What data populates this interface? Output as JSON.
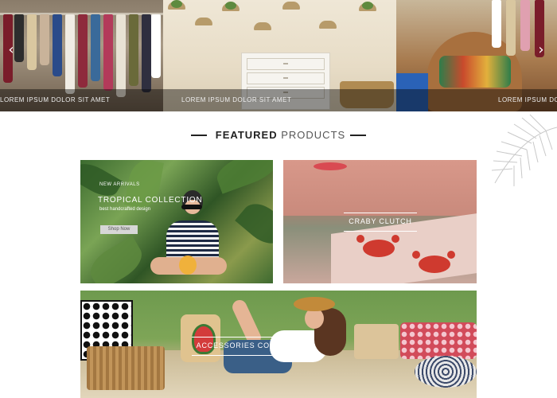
{
  "carousel": {
    "caption_left": "LOREM IPSUM DOLOR SIT AMET",
    "caption_center": "LOREM IPSUM DOLOR SIT AMET",
    "caption_right": "LOREM IPSUM DOLOR",
    "prev_icon": "‹",
    "next_icon": "›"
  },
  "featured": {
    "title_bold": "FEATURED",
    "title_light": "PRODUCTS"
  },
  "cards": {
    "tropical": {
      "eyebrow": "NEW ARRIVALS",
      "title": "TROPICAL COLLECTION",
      "subtitle": "best handcrafted design",
      "button": "Shop Now"
    },
    "clutch": {
      "title": "CRABY CLUTCH"
    },
    "accessories": {
      "title": "ACCESSORIES COLLECTION"
    }
  },
  "colors": {
    "heading": "#222222",
    "caption_bar": "rgba(0,0,0,0.42)",
    "button_bg": "#d7d7d7",
    "label_text": "#ffffff"
  },
  "icons": [
    "chevron-left-icon",
    "chevron-right-icon",
    "palm-leaf-icon"
  ]
}
